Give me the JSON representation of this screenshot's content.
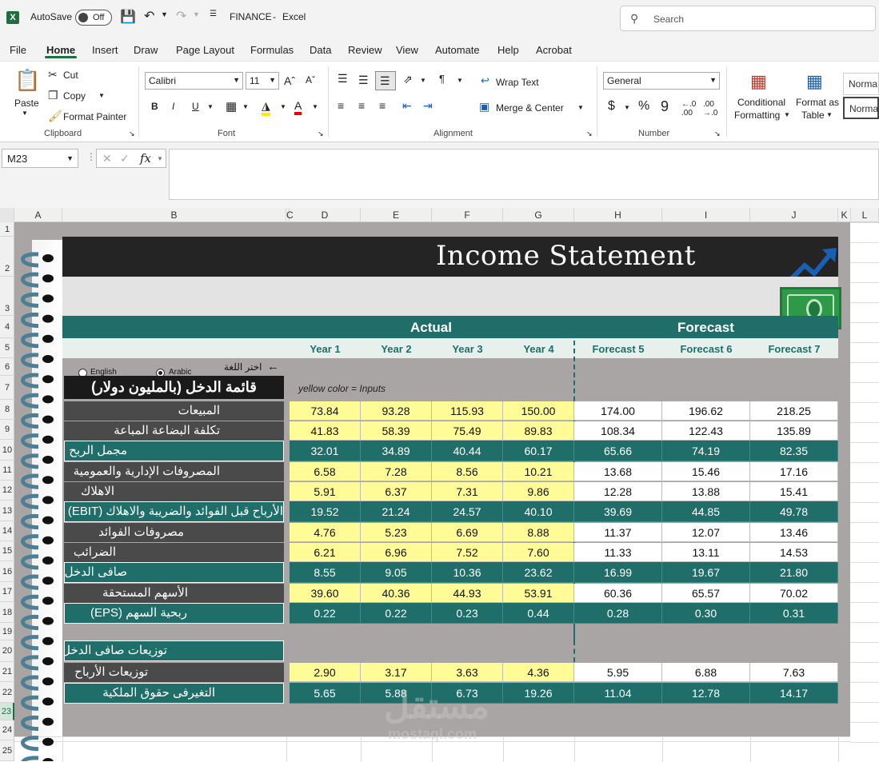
{
  "titlebar": {
    "autosave_label": "AutoSave",
    "autosave_state": "Off",
    "doc_title": "FINANCE",
    "separator": "-",
    "app_name": "Excel",
    "search_placeholder": "Search"
  },
  "menu": [
    "File",
    "Home",
    "Insert",
    "Draw",
    "Page Layout",
    "Formulas",
    "Data",
    "Review",
    "View",
    "Automate",
    "Help",
    "Acrobat"
  ],
  "ribbon": {
    "clipboard": {
      "paste": "Paste",
      "cut": "Cut",
      "copy": "Copy",
      "format_painter": "Format Painter",
      "label": "Clipboard"
    },
    "font": {
      "name": "Calibri",
      "size": "11",
      "label": "Font"
    },
    "alignment": {
      "wrap_text": "Wrap Text",
      "merge_center": "Merge & Center",
      "label": "Alignment"
    },
    "number": {
      "format": "General",
      "label": "Number"
    },
    "styles": {
      "conditional": "Conditional",
      "formatting": "Formatting",
      "format_as": "Format as",
      "table": "Table",
      "normal1": "Norma",
      "normal2": "Norma"
    }
  },
  "formula_bar": {
    "name_box": "M23",
    "fx": "fx",
    "content": ""
  },
  "columns": [
    "A",
    "B",
    "C",
    "D",
    "E",
    "F",
    "G",
    "H",
    "I",
    "J",
    "K",
    "L"
  ],
  "rows": [
    "1",
    "2",
    "3",
    "4",
    "5",
    "6",
    "7",
    "8",
    "9",
    "10",
    "11",
    "12",
    "13",
    "14",
    "15",
    "16",
    "17",
    "18",
    "19",
    "20",
    "21",
    "22",
    "23",
    "24",
    "25"
  ],
  "sheet": {
    "title": "Income Statement",
    "actual_label": "Actual",
    "forecast_label": "Forecast",
    "years": [
      "Year 1",
      "Year 2",
      "Year 3",
      "Year 4",
      "Forecast 5",
      "Forecast 6",
      "Forecast 7"
    ],
    "lang_english": "English",
    "lang_arabic": "Arabic",
    "lang_prompt": "اختر اللغة",
    "arrow": "🡐",
    "heading": "قائمة الدخل (بالمليون دولار)",
    "inputs_note": "yellow color = Inputs",
    "rows": [
      {
        "label": "المبيعات",
        "style": "dark",
        "values": [
          "73.84",
          "93.28",
          "115.93",
          "150.00",
          "174.00",
          "196.62",
          "218.25"
        ]
      },
      {
        "label": "تكلفة البضاعة المباعة",
        "style": "dark",
        "values": [
          "41.83",
          "58.39",
          "75.49",
          "89.83",
          "108.34",
          "122.43",
          "135.89"
        ]
      },
      {
        "label": "مجمل الربح",
        "style": "teal",
        "values": [
          "32.01",
          "34.89",
          "40.44",
          "60.17",
          "65.66",
          "74.19",
          "82.35"
        ]
      },
      {
        "label": "المصروفات الإدارية والعمومية",
        "style": "dark",
        "values": [
          "6.58",
          "7.28",
          "8.56",
          "10.21",
          "13.68",
          "15.46",
          "17.16"
        ]
      },
      {
        "label": "الاهلاك",
        "style": "dark",
        "values": [
          "5.91",
          "6.37",
          "7.31",
          "9.86",
          "12.28",
          "13.88",
          "15.41"
        ]
      },
      {
        "label": "الأرباح قبل الفوائد والضريبة والاهلاك (EBIT)",
        "style": "teal",
        "values": [
          "19.52",
          "21.24",
          "24.57",
          "40.10",
          "39.69",
          "44.85",
          "49.78"
        ]
      },
      {
        "label": "مصروفات الفوائد",
        "style": "dark",
        "values": [
          "4.76",
          "5.23",
          "6.69",
          "8.88",
          "11.37",
          "12.07",
          "13.46"
        ]
      },
      {
        "label": "الضرائب",
        "style": "dark",
        "values": [
          "6.21",
          "6.96",
          "7.52",
          "7.60",
          "11.33",
          "13.11",
          "14.53"
        ]
      },
      {
        "label": "صافى الدخل",
        "style": "teal",
        "values": [
          "8.55",
          "9.05",
          "10.36",
          "23.62",
          "16.99",
          "19.67",
          "21.80"
        ]
      },
      {
        "label": "الأسهم المستحقة",
        "style": "dark",
        "values": [
          "39.60",
          "40.36",
          "44.93",
          "53.91",
          "60.36",
          "65.57",
          "70.02"
        ]
      },
      {
        "label": "ربحية السهم (EPS)",
        "style": "teal",
        "values": [
          "0.22",
          "0.22",
          "0.23",
          "0.44",
          "0.28",
          "0.30",
          "0.31"
        ]
      }
    ],
    "dist_heading": "توزيعات صافى الدخل",
    "dist_rows": [
      {
        "label": "توزيعات الأرباح",
        "style": "dark",
        "values": [
          "2.90",
          "3.17",
          "3.63",
          "4.36",
          "5.95",
          "6.88",
          "7.63"
        ]
      },
      {
        "label": "التغيرفى حقوق الملكية",
        "style": "teal",
        "values": [
          "5.65",
          "5.88",
          "6.73",
          "19.26",
          "11.04",
          "12.78",
          "14.17"
        ]
      }
    ],
    "watermark": "مستقل",
    "watermark_sub": "mostaql.com"
  },
  "colors": {
    "teal": "#1f6e6a",
    "input_yellow": "#fffb97",
    "dark_label": "#4a4a4a",
    "sheet_bg": "#aaa5a5",
    "excel_green": "#1d6f42"
  }
}
